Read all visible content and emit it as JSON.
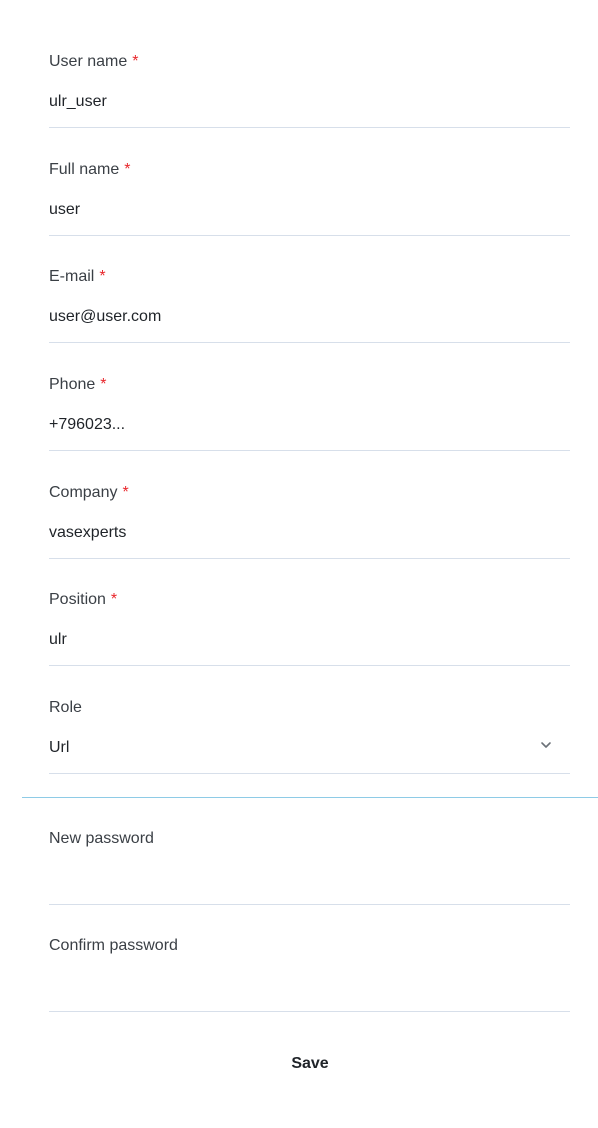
{
  "form": {
    "fields": [
      {
        "label": "User name",
        "required_mark": "*",
        "value": "ulr_user"
      },
      {
        "label": "Full name",
        "required_mark": "*",
        "value": "user"
      },
      {
        "label": "E-mail",
        "required_mark": "*",
        "value": "user@user.com"
      },
      {
        "label": "Phone",
        "required_mark": "*",
        "value": "+796023..."
      },
      {
        "label": "Company",
        "required_mark": "*",
        "value": "vasexperts"
      },
      {
        "label": "Position",
        "required_mark": "*",
        "value": "ulr"
      }
    ],
    "role": {
      "label": "Role",
      "value": "Url",
      "icon": "chevron-down-icon"
    },
    "new_password": {
      "label": "New password",
      "value": ""
    },
    "confirm_password": {
      "label": "Confirm password",
      "value": ""
    },
    "save_label": "Save"
  },
  "colors": {
    "required": "#e8262b",
    "divider": "#8ecbe6",
    "underline": "#d7dfea"
  }
}
